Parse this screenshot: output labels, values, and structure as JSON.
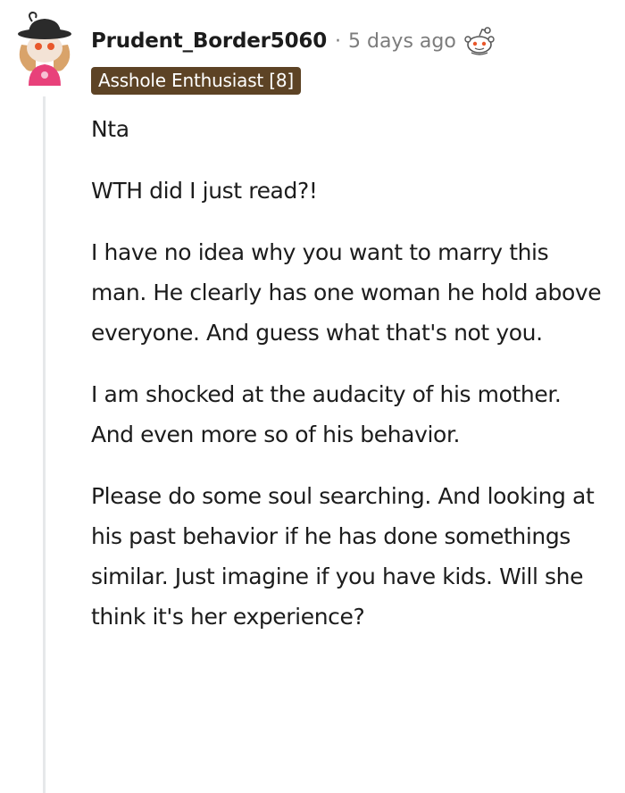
{
  "comment": {
    "username": "Prudent_Border5060",
    "separator": "·",
    "timestamp": "5 days ago",
    "icons": {
      "avatar": "user-avatar-icon",
      "award": "snoo-award-icon"
    },
    "flair": {
      "text": "Asshole Enthusiast [8]",
      "background": "#5d4325"
    },
    "paragraphs": [
      "Nta",
      "WTH did I just read?!",
      "I have no idea why you want to marry this man. He clearly has one woman he hold above everyone. And guess what that's not you.",
      "I am shocked at the audacity of his mother. And even more so of his behavior.",
      "Please do some soul searching. And looking at his past behavior if he has done somethings similar. Just imagine if you have kids. Will she think it's her experience?"
    ]
  }
}
